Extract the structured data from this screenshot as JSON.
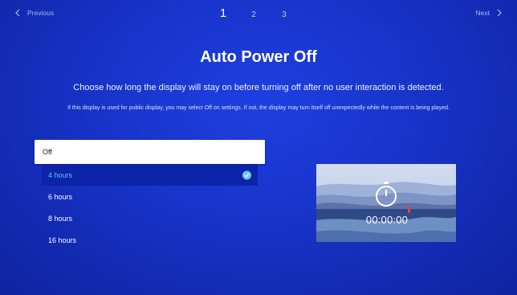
{
  "nav": {
    "previous_label": "Previous",
    "next_label": "Next",
    "steps": [
      "1",
      "2",
      "3"
    ],
    "active_step": 1
  },
  "page": {
    "title": "Auto Power Off",
    "subtitle": "Choose how long the display will stay on before turning off after no user interaction is detected.",
    "note": "If this display is used for public display, you may select Off on settings. If not, the display may turn itself off unexpectedly while the content is being played."
  },
  "options": [
    {
      "label": "Off",
      "state": "focused"
    },
    {
      "label": "4 hours",
      "state": "selected"
    },
    {
      "label": "6 hours",
      "state": "normal"
    },
    {
      "label": "8 hours",
      "state": "normal"
    },
    {
      "label": "16 hours",
      "state": "normal"
    }
  ],
  "preview": {
    "timer": "00:00:00",
    "icon": "stopwatch-icon"
  },
  "colors": {
    "background": "#1733c8",
    "selected_text": "#5fc8ff",
    "focused_bg": "#ffffff",
    "check": "#6cc9ff"
  }
}
